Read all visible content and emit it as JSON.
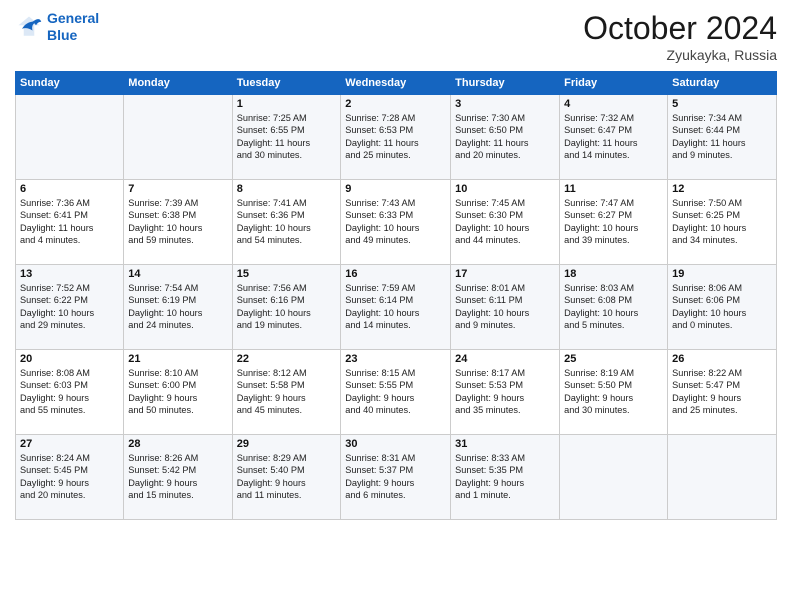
{
  "header": {
    "logo_line1": "General",
    "logo_line2": "Blue",
    "month": "October 2024",
    "location": "Zyukayka, Russia"
  },
  "weekdays": [
    "Sunday",
    "Monday",
    "Tuesday",
    "Wednesday",
    "Thursday",
    "Friday",
    "Saturday"
  ],
  "weeks": [
    [
      {
        "day": "",
        "info": ""
      },
      {
        "day": "",
        "info": ""
      },
      {
        "day": "1",
        "info": "Sunrise: 7:25 AM\nSunset: 6:55 PM\nDaylight: 11 hours\nand 30 minutes."
      },
      {
        "day": "2",
        "info": "Sunrise: 7:28 AM\nSunset: 6:53 PM\nDaylight: 11 hours\nand 25 minutes."
      },
      {
        "day": "3",
        "info": "Sunrise: 7:30 AM\nSunset: 6:50 PM\nDaylight: 11 hours\nand 20 minutes."
      },
      {
        "day": "4",
        "info": "Sunrise: 7:32 AM\nSunset: 6:47 PM\nDaylight: 11 hours\nand 14 minutes."
      },
      {
        "day": "5",
        "info": "Sunrise: 7:34 AM\nSunset: 6:44 PM\nDaylight: 11 hours\nand 9 minutes."
      }
    ],
    [
      {
        "day": "6",
        "info": "Sunrise: 7:36 AM\nSunset: 6:41 PM\nDaylight: 11 hours\nand 4 minutes."
      },
      {
        "day": "7",
        "info": "Sunrise: 7:39 AM\nSunset: 6:38 PM\nDaylight: 10 hours\nand 59 minutes."
      },
      {
        "day": "8",
        "info": "Sunrise: 7:41 AM\nSunset: 6:36 PM\nDaylight: 10 hours\nand 54 minutes."
      },
      {
        "day": "9",
        "info": "Sunrise: 7:43 AM\nSunset: 6:33 PM\nDaylight: 10 hours\nand 49 minutes."
      },
      {
        "day": "10",
        "info": "Sunrise: 7:45 AM\nSunset: 6:30 PM\nDaylight: 10 hours\nand 44 minutes."
      },
      {
        "day": "11",
        "info": "Sunrise: 7:47 AM\nSunset: 6:27 PM\nDaylight: 10 hours\nand 39 minutes."
      },
      {
        "day": "12",
        "info": "Sunrise: 7:50 AM\nSunset: 6:25 PM\nDaylight: 10 hours\nand 34 minutes."
      }
    ],
    [
      {
        "day": "13",
        "info": "Sunrise: 7:52 AM\nSunset: 6:22 PM\nDaylight: 10 hours\nand 29 minutes."
      },
      {
        "day": "14",
        "info": "Sunrise: 7:54 AM\nSunset: 6:19 PM\nDaylight: 10 hours\nand 24 minutes."
      },
      {
        "day": "15",
        "info": "Sunrise: 7:56 AM\nSunset: 6:16 PM\nDaylight: 10 hours\nand 19 minutes."
      },
      {
        "day": "16",
        "info": "Sunrise: 7:59 AM\nSunset: 6:14 PM\nDaylight: 10 hours\nand 14 minutes."
      },
      {
        "day": "17",
        "info": "Sunrise: 8:01 AM\nSunset: 6:11 PM\nDaylight: 10 hours\nand 9 minutes."
      },
      {
        "day": "18",
        "info": "Sunrise: 8:03 AM\nSunset: 6:08 PM\nDaylight: 10 hours\nand 5 minutes."
      },
      {
        "day": "19",
        "info": "Sunrise: 8:06 AM\nSunset: 6:06 PM\nDaylight: 10 hours\nand 0 minutes."
      }
    ],
    [
      {
        "day": "20",
        "info": "Sunrise: 8:08 AM\nSunset: 6:03 PM\nDaylight: 9 hours\nand 55 minutes."
      },
      {
        "day": "21",
        "info": "Sunrise: 8:10 AM\nSunset: 6:00 PM\nDaylight: 9 hours\nand 50 minutes."
      },
      {
        "day": "22",
        "info": "Sunrise: 8:12 AM\nSunset: 5:58 PM\nDaylight: 9 hours\nand 45 minutes."
      },
      {
        "day": "23",
        "info": "Sunrise: 8:15 AM\nSunset: 5:55 PM\nDaylight: 9 hours\nand 40 minutes."
      },
      {
        "day": "24",
        "info": "Sunrise: 8:17 AM\nSunset: 5:53 PM\nDaylight: 9 hours\nand 35 minutes."
      },
      {
        "day": "25",
        "info": "Sunrise: 8:19 AM\nSunset: 5:50 PM\nDaylight: 9 hours\nand 30 minutes."
      },
      {
        "day": "26",
        "info": "Sunrise: 8:22 AM\nSunset: 5:47 PM\nDaylight: 9 hours\nand 25 minutes."
      }
    ],
    [
      {
        "day": "27",
        "info": "Sunrise: 8:24 AM\nSunset: 5:45 PM\nDaylight: 9 hours\nand 20 minutes."
      },
      {
        "day": "28",
        "info": "Sunrise: 8:26 AM\nSunset: 5:42 PM\nDaylight: 9 hours\nand 15 minutes."
      },
      {
        "day": "29",
        "info": "Sunrise: 8:29 AM\nSunset: 5:40 PM\nDaylight: 9 hours\nand 11 minutes."
      },
      {
        "day": "30",
        "info": "Sunrise: 8:31 AM\nSunset: 5:37 PM\nDaylight: 9 hours\nand 6 minutes."
      },
      {
        "day": "31",
        "info": "Sunrise: 8:33 AM\nSunset: 5:35 PM\nDaylight: 9 hours\nand 1 minute."
      },
      {
        "day": "",
        "info": ""
      },
      {
        "day": "",
        "info": ""
      }
    ]
  ]
}
